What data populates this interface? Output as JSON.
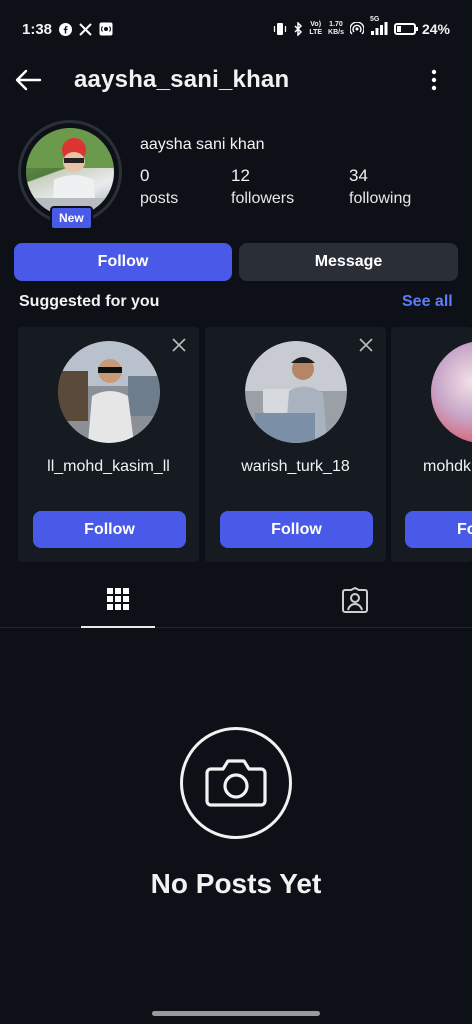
{
  "status_bar": {
    "time": "1:38",
    "lte_top": "Vo)",
    "lte_bottom": "LTE",
    "speed_top": "1.70",
    "speed_bottom": "KB/s",
    "net_5g": "5G",
    "battery": "24%",
    "battery_level": 0.24
  },
  "header": {
    "username": "aaysha_sani_khan"
  },
  "profile": {
    "display_name": "aaysha sani khan",
    "new_badge": "New",
    "stats": [
      {
        "value": "0",
        "label": "posts"
      },
      {
        "value": "12",
        "label": "followers"
      },
      {
        "value": "34",
        "label": "following"
      }
    ]
  },
  "actions": {
    "follow": "Follow",
    "message": "Message"
  },
  "suggestions": {
    "title": "Suggested for you",
    "see_all": "See all",
    "cards": [
      {
        "name": "ll_mohd_kasim_ll",
        "button": "Follow"
      },
      {
        "name": "warish_turk_18",
        "button": "Follow"
      },
      {
        "name": "mohdk",
        "button": "Fo"
      }
    ]
  },
  "empty_state": {
    "text": "No Posts Yet"
  },
  "colors": {
    "accent": "#4a5ae8",
    "link": "#5b7cff",
    "background": "#0d1117",
    "card": "#161b22"
  }
}
